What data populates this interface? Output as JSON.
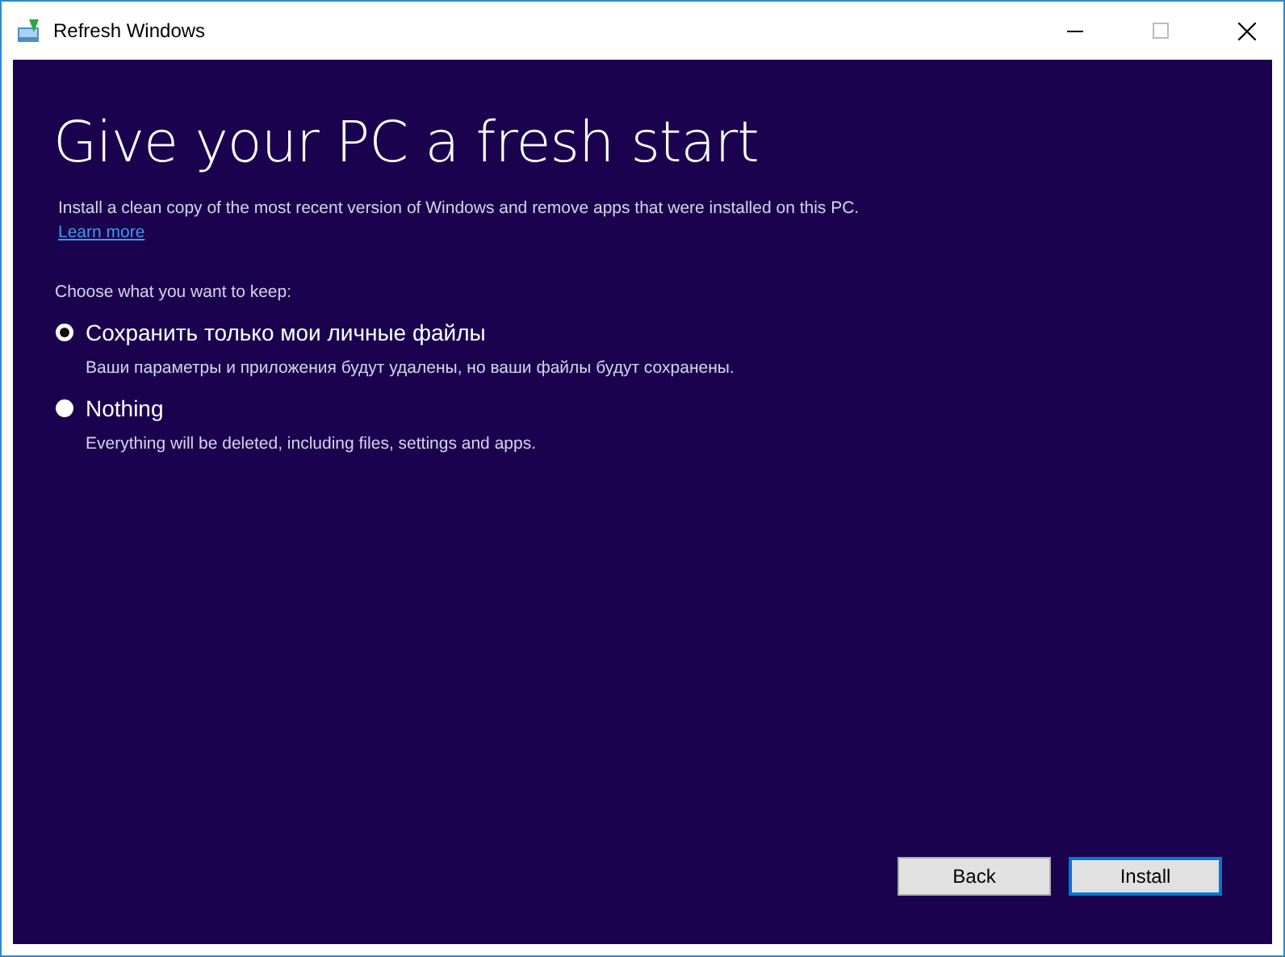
{
  "window": {
    "title": "Refresh Windows"
  },
  "heading": "Give your PC a fresh start",
  "description": "Install a clean copy of the most recent version of Windows and remove apps that were installed on this PC.",
  "learn_more": "Learn more",
  "prompt": "Choose what you want to keep:",
  "options": [
    {
      "label": "Сохранить только мои личные файлы",
      "detail": "Ваши параметры и приложения будут удалены, но ваши файлы будут сохранены.",
      "selected": true
    },
    {
      "label": "Nothing",
      "detail": "Everything will be deleted, including files, settings and apps.",
      "selected": false
    }
  ],
  "buttons": [
    {
      "label": "Back",
      "default": false
    },
    {
      "label": "Install",
      "default": true
    }
  ]
}
